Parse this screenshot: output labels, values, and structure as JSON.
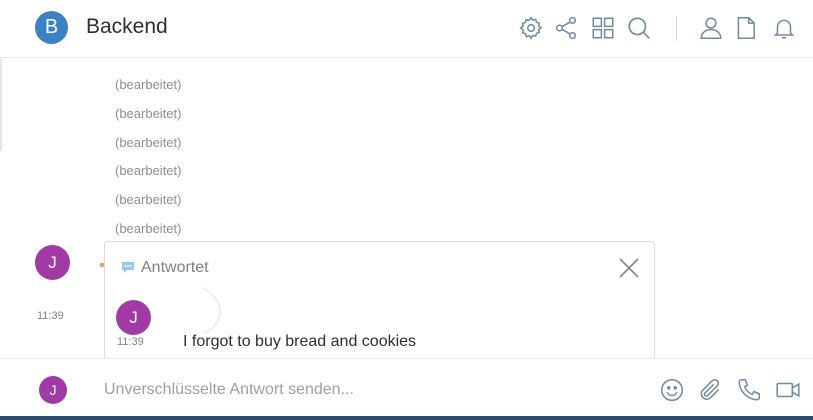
{
  "header": {
    "room_initial": "B",
    "room_title": "Backend",
    "icons": [
      "gear-icon",
      "share-icon",
      "grid-icon",
      "search-icon",
      "person-icon",
      "file-icon",
      "bell-icon"
    ]
  },
  "timeline": {
    "edited_labels": [
      "(bearbeitet)",
      "(bearbeitet)",
      "(bearbeitet)",
      "(bearbeitet)",
      "(bearbeitet)",
      "(bearbeitet)"
    ],
    "sender_initial": "J",
    "time": "11:39"
  },
  "reply": {
    "label": "Antwortet",
    "sender_initial": "J",
    "time": "11:39",
    "text": "I forgot to buy bread and cookies"
  },
  "composer": {
    "user_initial": "J",
    "placeholder": "Unverschlüsselte Antwort senden...",
    "icons": [
      "emoji-icon",
      "attachment-icon",
      "phone-icon",
      "video-icon"
    ]
  },
  "colors": {
    "room_avatar": "#3b82c4",
    "user_avatar": "#a23aa6",
    "icon": "#6f8aa3"
  }
}
